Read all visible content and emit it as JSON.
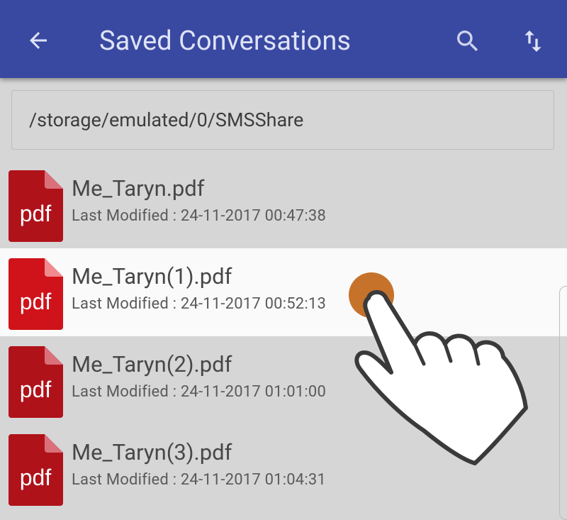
{
  "app_bar": {
    "title": "Saved Conversations",
    "back_icon": "arrow-left-icon",
    "search_icon": "search-icon",
    "sort_icon": "sort-arrows-icon",
    "background_color": "#3949a1"
  },
  "path_field": {
    "value": "/storage/emulated/0/SMSShare"
  },
  "files": [
    {
      "name": "Me_Taryn.pdf",
      "modified": "Last Modified : 24-11-2017 00:47:38",
      "icon_label": "pdf",
      "selected": false
    },
    {
      "name": "Me_Taryn(1).pdf",
      "modified": "Last Modified : 24-11-2017 00:52:13",
      "icon_label": "pdf",
      "selected": true
    },
    {
      "name": "Me_Taryn(2).pdf",
      "modified": "Last Modified : 24-11-2017 01:01:00",
      "icon_label": "pdf",
      "selected": false
    },
    {
      "name": "Me_Taryn(3).pdf",
      "modified": "Last Modified : 24-11-2017 01:04:31",
      "icon_label": "pdf",
      "selected": false
    }
  ],
  "colors": {
    "pdf_icon": "#c2121a",
    "pdf_icon_fold": "#e57373",
    "selected_row": "#fafafa",
    "list_background": "#d6d6d6",
    "touch_indicator": "#c7722b"
  }
}
